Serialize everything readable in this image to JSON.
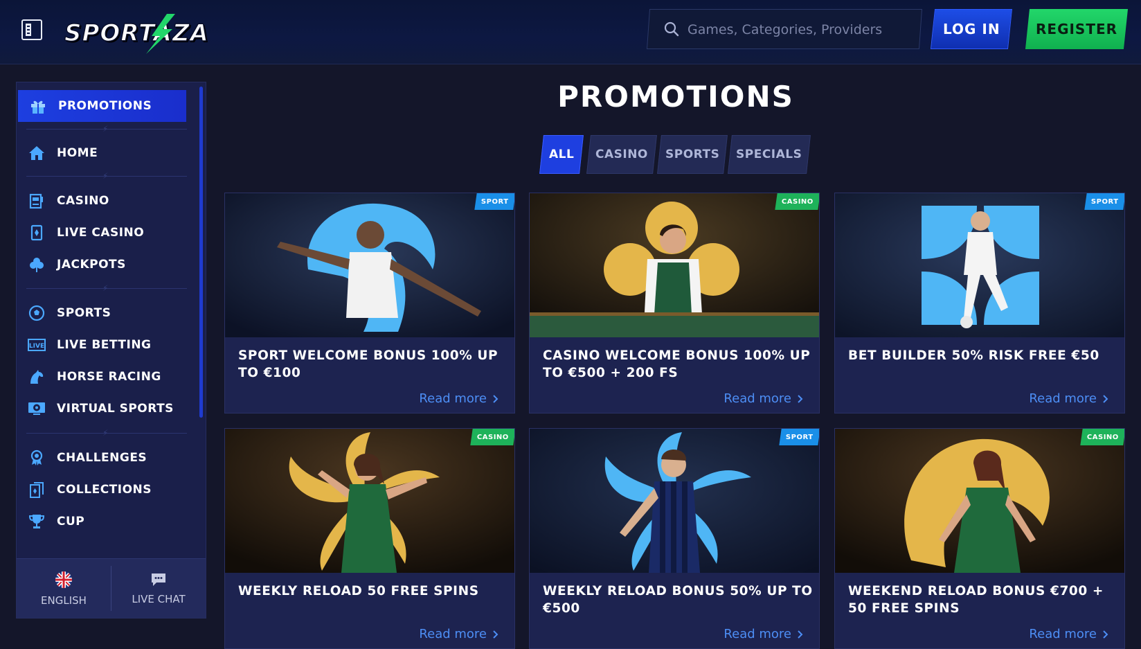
{
  "header": {
    "logo_text": "SPORTAZA",
    "search_placeholder": "Games, Categories, Providers",
    "login_label": "LOG IN",
    "register_label": "REGISTER"
  },
  "sidebar": {
    "items": [
      {
        "label": "PROMOTIONS",
        "icon": "gift-icon",
        "active": true
      },
      {
        "label": "HOME",
        "icon": "home-icon"
      },
      {
        "label": "CASINO",
        "icon": "slot-machine-icon"
      },
      {
        "label": "LIVE CASINO",
        "icon": "card-icon"
      },
      {
        "label": "JACKPOTS",
        "icon": "clover-icon"
      },
      {
        "label": "SPORTS",
        "icon": "soccer-ball-icon"
      },
      {
        "label": "LIVE BETTING",
        "icon": "live-icon"
      },
      {
        "label": "HORSE RACING",
        "icon": "horse-icon"
      },
      {
        "label": "VIRTUAL SPORTS",
        "icon": "virtual-sports-icon"
      },
      {
        "label": "CHALLENGES",
        "icon": "medal-icon"
      },
      {
        "label": "COLLECTIONS",
        "icon": "cards-collection-icon"
      },
      {
        "label": "CUP",
        "icon": "trophy-icon"
      }
    ],
    "footer": {
      "language_label": "ENGLISH",
      "chat_label": "LIVE CHAT"
    }
  },
  "main": {
    "title": "PROMOTIONS",
    "tabs": [
      {
        "label": "ALL",
        "active": true
      },
      {
        "label": "CASINO"
      },
      {
        "label": "SPORTS"
      },
      {
        "label": "SPECIALS"
      }
    ],
    "cards": [
      {
        "badge": "SPORT",
        "title": "SPORT WELCOME BONUS 100% UP TO €100",
        "link": "Read more"
      },
      {
        "badge": "CASINO",
        "title": "CASINO WELCOME BONUS 100% UP TO €500 + 200 FS",
        "link": "Read more"
      },
      {
        "badge": "SPORT",
        "title": "BET BUILDER 50% RISK FREE €50",
        "link": "Read more"
      },
      {
        "badge": "CASINO",
        "title": "WEEKLY RELOAD 50 FREE SPINS",
        "link": "Read more"
      },
      {
        "badge": "SPORT",
        "title": "WEEKLY RELOAD BONUS 50% UP TO €500",
        "link": "Read more"
      },
      {
        "badge": "CASINO",
        "title": "WEEKEND RELOAD BONUS €700 + 50 FREE SPINS",
        "link": "Read more"
      }
    ]
  },
  "colors": {
    "accent_blue": "#1d3fe0",
    "register_green": "#22d66a",
    "link_blue": "#4d8ef5",
    "sport_badge": "#1a8fe8",
    "casino_badge": "#1eb25a"
  }
}
